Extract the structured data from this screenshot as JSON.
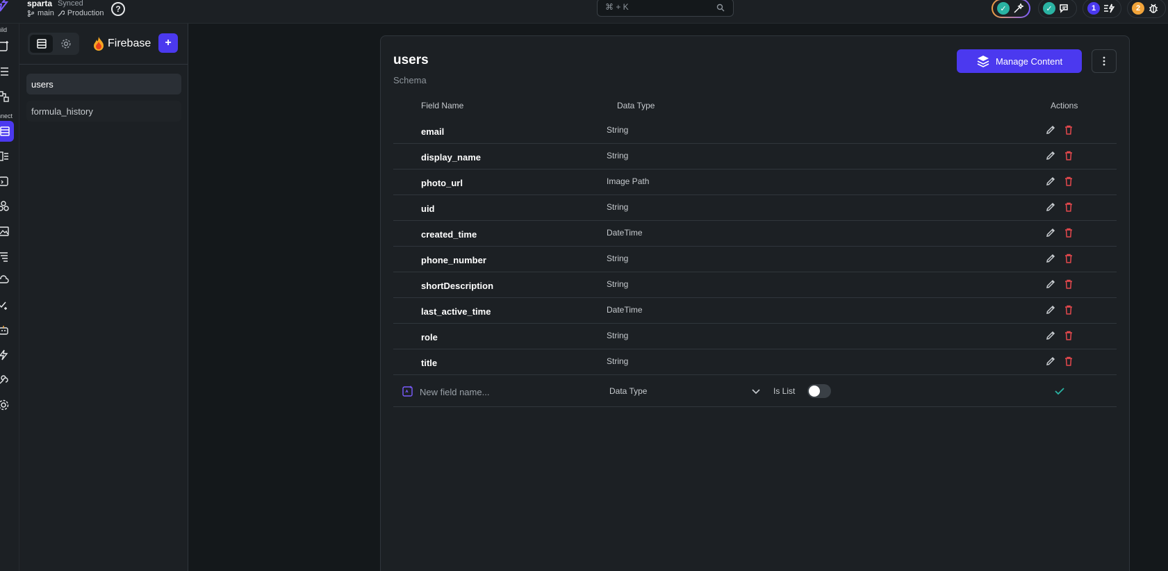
{
  "topbar": {
    "project_name": "sparta",
    "sync_status": "Synced",
    "branch": "main",
    "environment": "Production",
    "help_symbol": "?",
    "search_shortcut": "⌘ + K",
    "badges": [
      {
        "icon": "check-icon",
        "color": "#2ab3a3"
      },
      {
        "icon": "check-icon",
        "color": "#2ab3a3"
      },
      {
        "count": "1",
        "color": "#4b39ef"
      },
      {
        "count": "2",
        "color": "#f2a43a"
      }
    ]
  },
  "rail": {
    "labels": {
      "build": "uild",
      "connect": "nnect"
    },
    "accent": "#4b39ef"
  },
  "panel": {
    "title": "Firebase",
    "add_symbol": "+",
    "collections": [
      {
        "label": "users",
        "selected": true
      },
      {
        "label": "formula_history",
        "selected": false
      }
    ]
  },
  "schema": {
    "collection_name": "users",
    "subtitle": "Schema",
    "manage_button": "Manage Content",
    "columns": {
      "field": "Field Name",
      "type": "Data Type",
      "actions": "Actions"
    },
    "fields": [
      {
        "name": "email",
        "type": "String"
      },
      {
        "name": "display_name",
        "type": "String"
      },
      {
        "name": "photo_url",
        "type": "Image Path"
      },
      {
        "name": "uid",
        "type": "String"
      },
      {
        "name": "created_time",
        "type": "DateTime"
      },
      {
        "name": "phone_number",
        "type": "String"
      },
      {
        "name": "shortDescription",
        "type": "String"
      },
      {
        "name": "last_active_time",
        "type": "DateTime"
      },
      {
        "name": "role",
        "type": "String"
      },
      {
        "name": "title",
        "type": "String"
      }
    ],
    "new_field": {
      "placeholder": "New field name...",
      "value": "",
      "data_type_label": "Data Type",
      "is_list_label": "Is List",
      "is_list": false
    }
  },
  "colors": {
    "accent": "#4b39ef",
    "danger": "#e5484d",
    "success": "#2ab3a3"
  }
}
